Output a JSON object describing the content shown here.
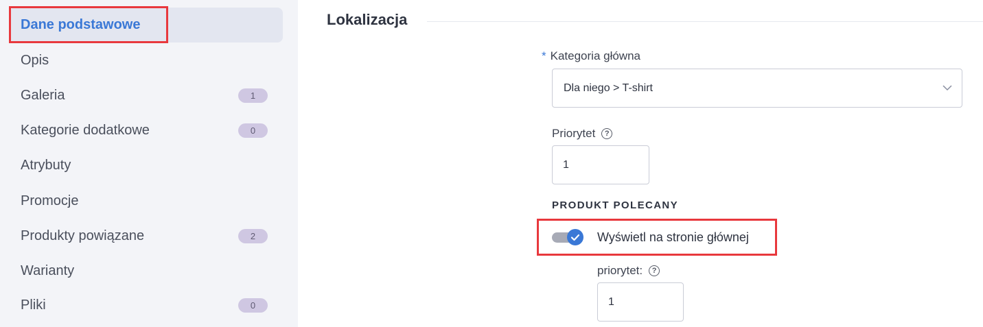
{
  "sidebar": {
    "items": [
      {
        "label": "Dane podstawowe",
        "badge": null,
        "active": true
      },
      {
        "label": "Opis",
        "badge": null
      },
      {
        "label": "Galeria",
        "badge": "1"
      },
      {
        "label": "Kategorie dodatkowe",
        "badge": "0"
      },
      {
        "label": "Atrybuty",
        "badge": null
      },
      {
        "label": "Promocje",
        "badge": null
      },
      {
        "label": "Produkty powiązane",
        "badge": "2"
      },
      {
        "label": "Warianty",
        "badge": null
      },
      {
        "label": "Pliki",
        "badge": "0"
      }
    ]
  },
  "main": {
    "section_title": "Lokalizacja",
    "main_category": {
      "required_marker": "*",
      "label": "Kategoria główna",
      "value": "Dla niego > T-shirt"
    },
    "priority": {
      "label": "Priorytet",
      "value": "1"
    },
    "featured": {
      "heading": "PRODUKT POLECANY",
      "toggle_label": "Wyświetl na stronie głównej",
      "toggle_on": true,
      "priority_label": "priorytet:",
      "priority_value": "1"
    }
  },
  "icons": {
    "help": "help-circle-icon",
    "chevron": "chevron-down-icon",
    "check": "check-icon"
  },
  "colors": {
    "accent": "#3a78d6",
    "highlight": "#e8383d",
    "sidebar_bg": "#f3f4f8",
    "badge_bg": "#cfc7e2"
  }
}
